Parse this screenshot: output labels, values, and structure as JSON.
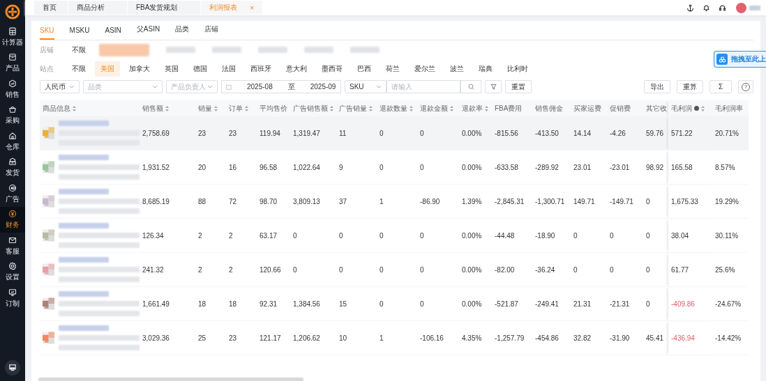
{
  "sidebar": {
    "items": [
      {
        "label": "计算器",
        "selected": false
      },
      {
        "label": "产品",
        "selected": false
      },
      {
        "label": "销售",
        "selected": false
      },
      {
        "label": "采购",
        "selected": false
      },
      {
        "label": "仓库",
        "selected": false
      },
      {
        "label": "发货",
        "selected": false
      },
      {
        "label": "广告",
        "selected": false
      },
      {
        "label": "财务",
        "selected": true
      },
      {
        "label": "客服",
        "selected": false
      },
      {
        "label": "设置",
        "selected": false
      },
      {
        "label": "订制",
        "selected": false
      }
    ]
  },
  "top_tabs": [
    {
      "label": "首页",
      "selected": false,
      "closable": false
    },
    {
      "label": "商品分析",
      "selected": false,
      "closable": false
    },
    {
      "label": "FBA发货规划",
      "selected": false,
      "closable": false
    },
    {
      "label": "利润报表",
      "selected": true,
      "closable": true
    }
  ],
  "close_symbol": "×",
  "upload_badge": "拖拽至此上",
  "view_tabs": [
    {
      "label": "SKU",
      "selected": true
    },
    {
      "label": "MSKU",
      "selected": false
    },
    {
      "label": "ASIN",
      "selected": false
    },
    {
      "label": "父ASIN",
      "selected": false
    },
    {
      "label": "品类",
      "selected": false
    },
    {
      "label": "店铺",
      "selected": false
    }
  ],
  "store_filter": {
    "label": "店铺",
    "options": [
      {
        "label": "不限",
        "selected": false
      }
    ],
    "redacted_options": [
      {
        "selected": true
      },
      {
        "selected": false
      },
      {
        "selected": false
      },
      {
        "selected": false
      },
      {
        "selected": false
      },
      {
        "selected": false
      }
    ]
  },
  "site_filter": {
    "label": "站点",
    "options": [
      {
        "label": "不限",
        "selected": false
      },
      {
        "label": "美国",
        "selected": true
      },
      {
        "label": "加拿大",
        "selected": false
      },
      {
        "label": "英国",
        "selected": false
      },
      {
        "label": "德国",
        "selected": false
      },
      {
        "label": "法国",
        "selected": false
      },
      {
        "label": "西班牙",
        "selected": false
      },
      {
        "label": "意大利",
        "selected": false
      },
      {
        "label": "墨西哥",
        "selected": false
      },
      {
        "label": "巴西",
        "selected": false
      },
      {
        "label": "荷兰",
        "selected": false
      },
      {
        "label": "爱尔兰",
        "selected": false
      },
      {
        "label": "波兰",
        "selected": false
      },
      {
        "label": "瑞典",
        "selected": false
      },
      {
        "label": "比利时",
        "selected": false
      }
    ]
  },
  "toolbar": {
    "currency": {
      "value": "人民币"
    },
    "category": {
      "placeholder": "品类"
    },
    "owner": {
      "placeholder": "产品负责人"
    },
    "date_range": {
      "start": "2025-08",
      "separator": "至",
      "end": "2025-09"
    },
    "search_type": {
      "value": "SKU"
    },
    "search": {
      "placeholder": "请输入"
    },
    "buttons": [
      {
        "label": "重置"
      }
    ],
    "right_buttons": [
      {
        "label": "导出",
        "kind": "text"
      },
      {
        "label": "重算",
        "kind": "text"
      },
      {
        "label": "Σ",
        "kind": "text"
      },
      {
        "label": "?",
        "kind": "help"
      }
    ]
  },
  "table": {
    "columns": [
      {
        "label": "商品信息",
        "sortable": true,
        "info": false
      },
      {
        "label": "销售额",
        "sortable": true,
        "info": false
      },
      {
        "label": "销量",
        "sortable": true,
        "info": false
      },
      {
        "label": "订单",
        "sortable": true,
        "info": false
      },
      {
        "label": "平均售价",
        "sortable": false,
        "info": false
      },
      {
        "label": "广告销售额",
        "sortable": true,
        "info": false
      },
      {
        "label": "广告销量",
        "sortable": true,
        "info": false
      },
      {
        "label": "退款数量",
        "sortable": true,
        "info": false
      },
      {
        "label": "退款金额",
        "sortable": true,
        "info": false
      },
      {
        "label": "退款率",
        "sortable": true,
        "info": false
      },
      {
        "label": "FBA费用",
        "sortable": false,
        "info": false
      },
      {
        "label": "销售佣金",
        "sortable": false,
        "info": false
      },
      {
        "label": "买家运费",
        "sortable": false,
        "info": false
      },
      {
        "label": "促销费",
        "sortable": false,
        "info": false
      },
      {
        "label": "其它收",
        "sortable": false,
        "info": false
      },
      {
        "label": "毛利润",
        "sortable": true,
        "info": true
      },
      {
        "label": "毛利润率",
        "sortable": false,
        "info": false
      }
    ],
    "rows": [
      {
        "highlighted": true,
        "loss": false,
        "cells": [
          "",
          "2,758.69",
          "23",
          "23",
          "119.94",
          "1,319.47",
          "11",
          "0",
          "0",
          "0.00%",
          "-815.56",
          "-413.50",
          "14.14",
          "-4.26",
          "59.76",
          "571.22",
          "20.71%"
        ]
      },
      {
        "highlighted": false,
        "loss": false,
        "cells": [
          "",
          "1,931.52",
          "20",
          "16",
          "96.58",
          "1,022.64",
          "9",
          "0",
          "0",
          "0.00%",
          "-633.58",
          "-289.92",
          "23.01",
          "-23.01",
          "98.92",
          "165.58",
          "8.57%"
        ]
      },
      {
        "highlighted": false,
        "loss": false,
        "cells": [
          "",
          "8,685.19",
          "88",
          "72",
          "98.70",
          "3,809.13",
          "37",
          "1",
          "-86.90",
          "1.39%",
          "-2,845.31",
          "-1,300.71",
          "149.71",
          "-149.71",
          "0",
          "1,675.33",
          "19.29%"
        ]
      },
      {
        "highlighted": false,
        "loss": false,
        "cells": [
          "",
          "126.34",
          "2",
          "2",
          "63.17",
          "0",
          "0",
          "0",
          "0",
          "0.00%",
          "-44.48",
          "-18.90",
          "0",
          "0",
          "0",
          "38.04",
          "30.11%"
        ]
      },
      {
        "highlighted": false,
        "loss": false,
        "cells": [
          "",
          "241.32",
          "2",
          "2",
          "120.66",
          "0",
          "0",
          "0",
          "0",
          "0.00%",
          "-82.00",
          "-36.24",
          "0",
          "0",
          "0",
          "61.77",
          "25.6%"
        ]
      },
      {
        "highlighted": false,
        "loss": true,
        "cells": [
          "",
          "1,661.49",
          "18",
          "18",
          "92.31",
          "1,384.56",
          "15",
          "0",
          "0",
          "0.00%",
          "-521.87",
          "-249.41",
          "21.31",
          "-21.31",
          "0",
          "-409.86",
          "-24.67%"
        ]
      },
      {
        "highlighted": false,
        "loss": true,
        "cells": [
          "",
          "3,029.36",
          "25",
          "23",
          "121.17",
          "1,206.62",
          "10",
          "1",
          "-106.16",
          "4.35%",
          "-1,257.79",
          "-454.86",
          "32.82",
          "-31.90",
          "45.41",
          "-436.94",
          "-14.42%"
        ]
      }
    ]
  }
}
